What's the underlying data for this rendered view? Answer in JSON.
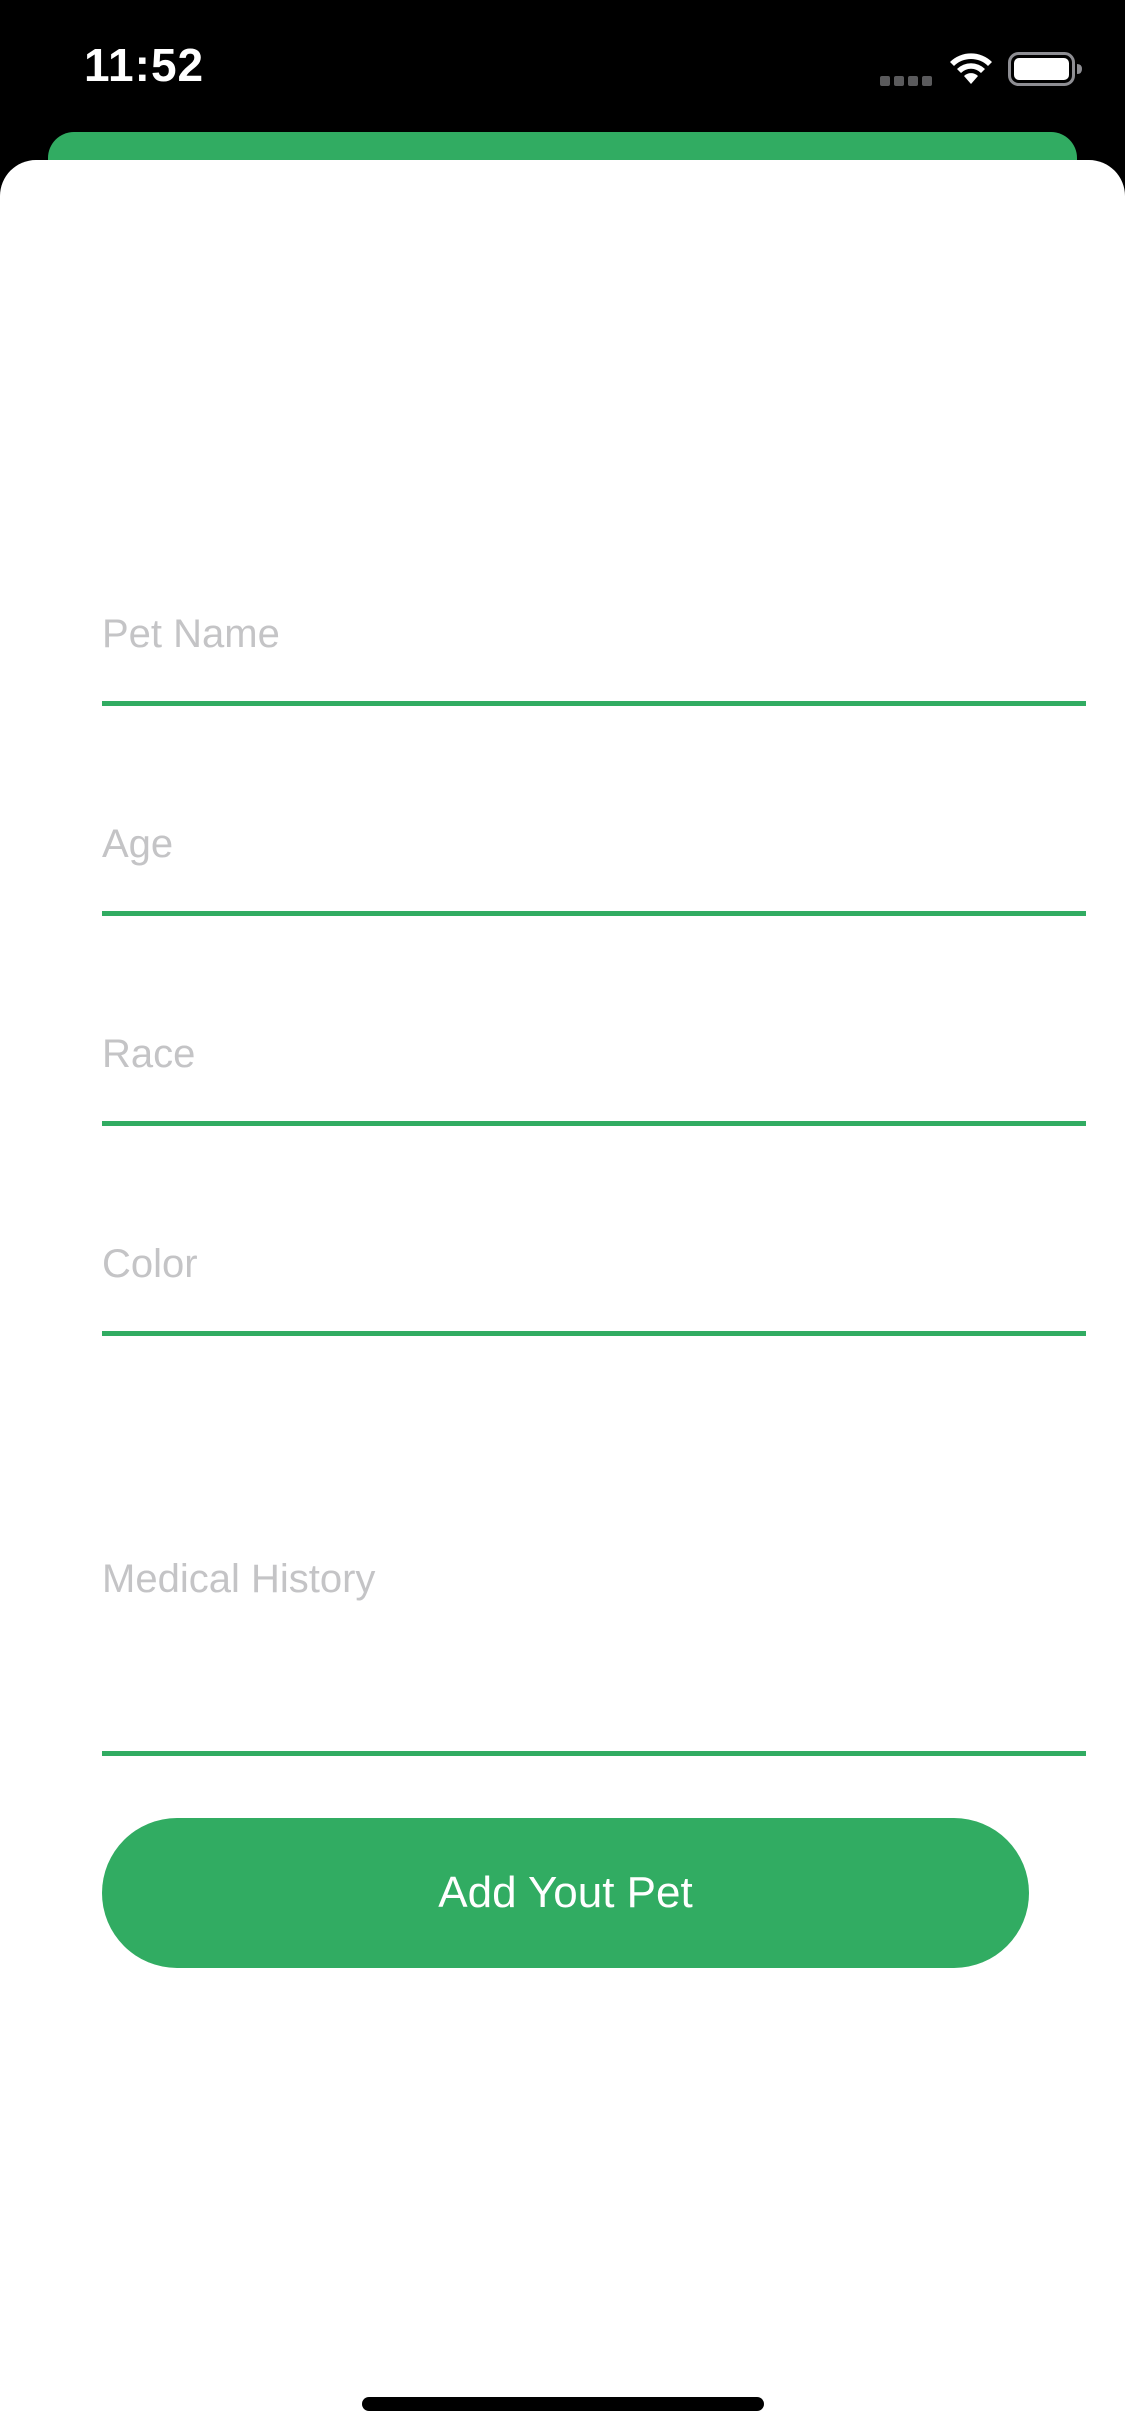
{
  "status_bar": {
    "time": "11:52",
    "icons": [
      "signal-icon",
      "wifi-icon",
      "battery-icon"
    ]
  },
  "form": {
    "fields": [
      {
        "name": "pet-name",
        "placeholder": "Pet Name",
        "value": ""
      },
      {
        "name": "age",
        "placeholder": "Age",
        "value": ""
      },
      {
        "name": "race",
        "placeholder": "Race",
        "value": ""
      },
      {
        "name": "color",
        "placeholder": "Color",
        "value": ""
      },
      {
        "name": "medical-history",
        "placeholder": "Medical History",
        "value": ""
      }
    ],
    "submit_label": "Add Yout Pet"
  },
  "colors": {
    "accent": "#31ac62",
    "placeholder": "#c4c4c6",
    "background": "#ffffff",
    "status_bar": "#000000"
  }
}
